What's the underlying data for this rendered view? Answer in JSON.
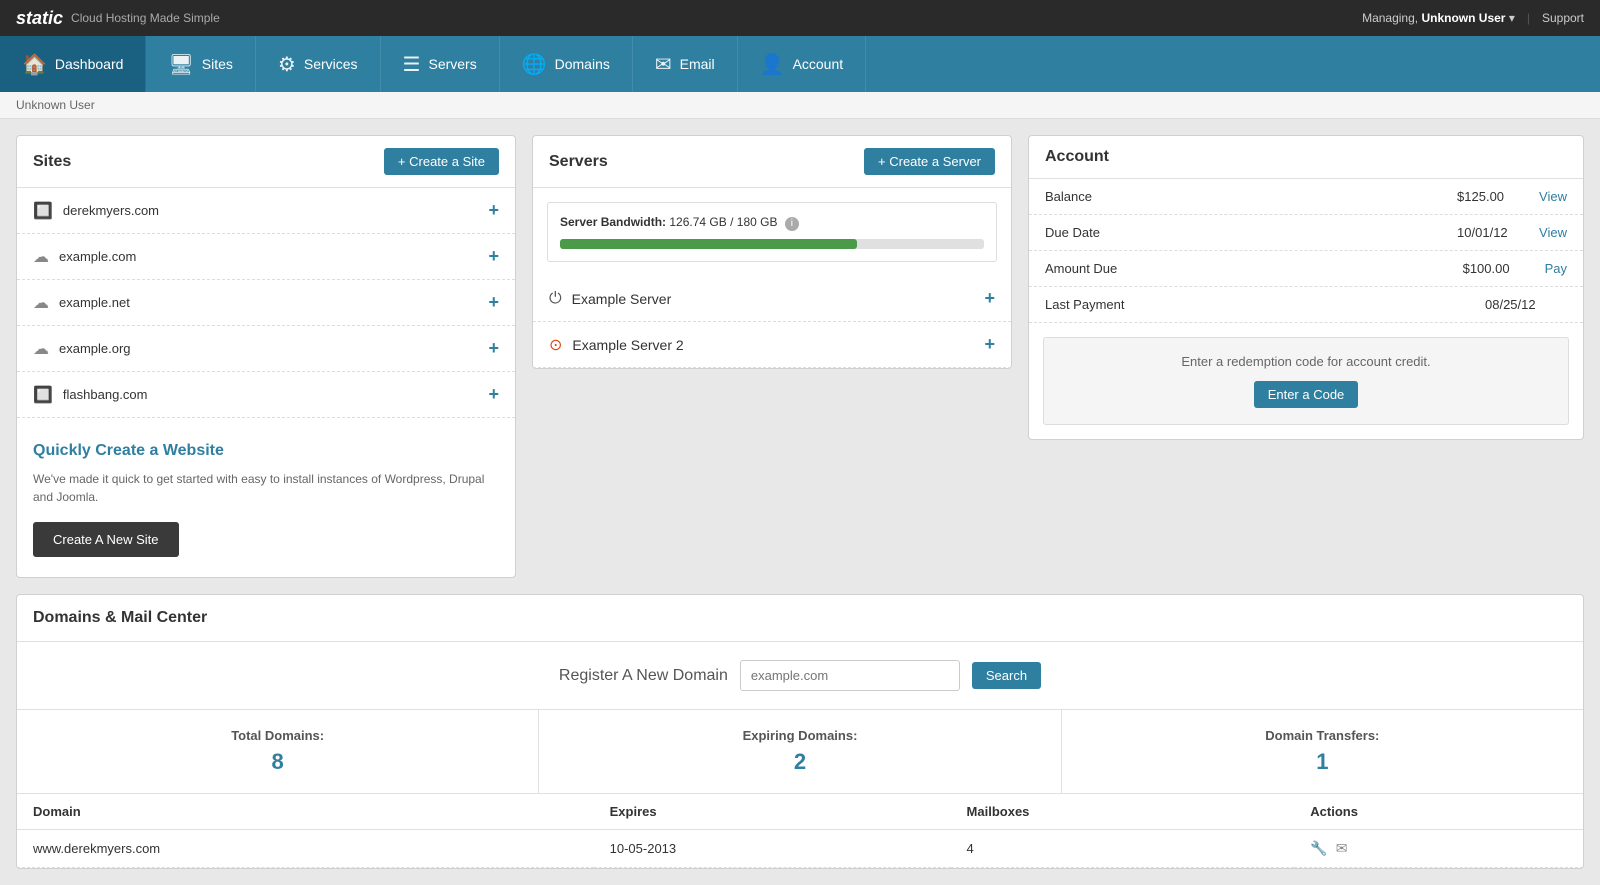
{
  "topbar": {
    "brand_logo": "static",
    "brand_tagline": "Cloud Hosting Made Simple",
    "managing_label": "Managing,",
    "managing_user": "Unknown User",
    "dropdown_icon": "▾",
    "separator": "|",
    "support_label": "Support"
  },
  "navbar": {
    "items": [
      {
        "id": "dashboard",
        "label": "Dashboard",
        "icon": "🏠",
        "active": true
      },
      {
        "id": "sites",
        "label": "Sites",
        "icon": "🖥",
        "active": false
      },
      {
        "id": "services",
        "label": "Services",
        "icon": "🔧",
        "active": false
      },
      {
        "id": "servers",
        "label": "Servers",
        "icon": "🖧",
        "active": false
      },
      {
        "id": "domains",
        "label": "Domains",
        "icon": "🌐",
        "active": false
      },
      {
        "id": "email",
        "label": "Email",
        "icon": "✉",
        "active": false
      },
      {
        "id": "account",
        "label": "Account",
        "icon": "👤",
        "active": false
      }
    ]
  },
  "breadcrumb": "Unknown User",
  "sites": {
    "panel_title": "Sites",
    "create_button": "+ Create a Site",
    "items": [
      {
        "name": "derekmyers.com",
        "icon": "🔲"
      },
      {
        "name": "example.com",
        "icon": "☁"
      },
      {
        "name": "example.net",
        "icon": "☁"
      },
      {
        "name": "example.org",
        "icon": "☁"
      },
      {
        "name": "flashbang.com",
        "icon": "🔲"
      }
    ],
    "quick_title": "Quickly Create a Website",
    "quick_desc": "We've made it quick to get started with easy to install instances of Wordpress, Drupal and Joomla.",
    "quick_button": "Create A New Site"
  },
  "servers": {
    "panel_title": "Servers",
    "create_button": "+ Create a Server",
    "bandwidth_label": "Server Bandwidth:",
    "bandwidth_used": "126.74 GB",
    "bandwidth_total": "180 GB",
    "bandwidth_pct": 70,
    "items": [
      {
        "name": "Example Server",
        "icon": "power",
        "icon_color": "#555"
      },
      {
        "name": "Example Server 2",
        "icon": "ubuntu",
        "icon_color": "#dd4814"
      }
    ]
  },
  "account": {
    "panel_title": "Account",
    "rows": [
      {
        "label": "Balance",
        "value": "$125.00",
        "link": "View"
      },
      {
        "label": "Due Date",
        "value": "10/01/12",
        "link": "View"
      },
      {
        "label": "Amount Due",
        "value": "$100.00",
        "link": "Pay"
      },
      {
        "label": "Last Payment",
        "value": "08/25/12",
        "link": ""
      }
    ],
    "redemption_text": "Enter a redemption code for account credit.",
    "redemption_button": "Enter a Code"
  },
  "domains": {
    "panel_title": "Domains & Mail Center",
    "register_label": "Register A New Domain",
    "search_placeholder": "example.com",
    "search_button": "Search",
    "stats": [
      {
        "label": "Total Domains:",
        "value": "8"
      },
      {
        "label": "Expiring Domains:",
        "value": "2"
      },
      {
        "label": "Domain Transfers:",
        "value": "1"
      }
    ],
    "table_headers": [
      "Domain",
      "Expires",
      "Mailboxes",
      "Actions"
    ],
    "table_rows": [
      {
        "domain": "www.derekmyers.com",
        "expires": "10-05-2013",
        "mailboxes": "4",
        "actions": [
          "wrench",
          "mail"
        ]
      }
    ]
  }
}
